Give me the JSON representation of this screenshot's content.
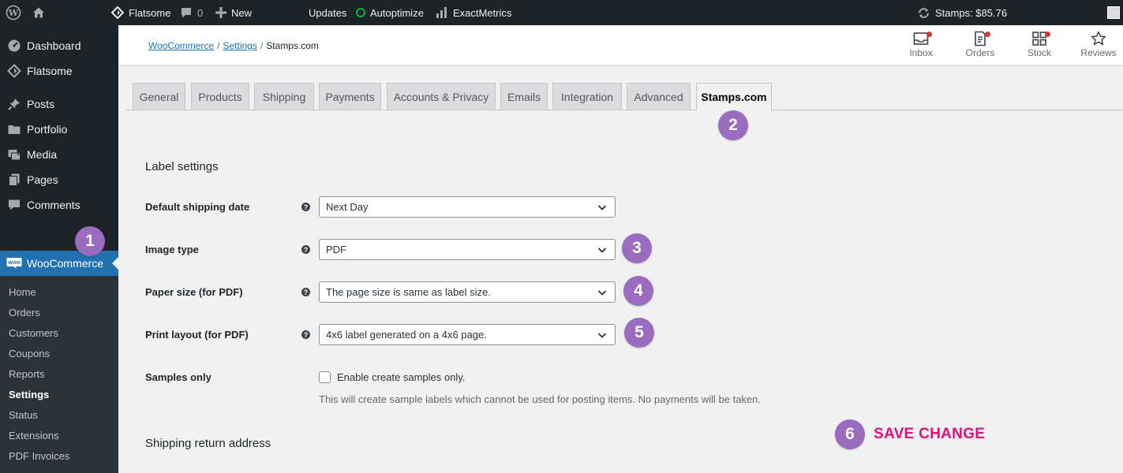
{
  "admin_bar": {
    "site_name": "Flatsome",
    "comments_count": "0",
    "new_label": "New",
    "updates_label": "Updates",
    "autoptimize_label": "Autoptimize",
    "exactmetrics_label": "ExactMetrics",
    "stamps_balance": "Stamps: $85.76"
  },
  "sidebar": {
    "items": [
      {
        "label": "Dashboard",
        "icon": "dashboard-icon"
      },
      {
        "label": "Flatsome",
        "icon": "flatsome-icon"
      },
      {
        "label": "Posts",
        "icon": "pin-icon"
      },
      {
        "label": "Portfolio",
        "icon": "folder-icon"
      },
      {
        "label": "Media",
        "icon": "media-icon"
      },
      {
        "label": "Pages",
        "icon": "pages-icon"
      },
      {
        "label": "Comments",
        "icon": "comment-icon"
      },
      {
        "label": "WooCommerce",
        "icon": "woo-icon"
      }
    ],
    "submenu": [
      "Home",
      "Orders",
      "Customers",
      "Coupons",
      "Reports",
      "Settings",
      "Status",
      "Extensions",
      "PDF Invoices"
    ],
    "active_submenu": "Settings"
  },
  "header": {
    "breadcrumb": {
      "woocommerce": "WooCommerce",
      "settings": "Settings",
      "current": "Stamps.com",
      "sep": "/"
    },
    "buttons": [
      {
        "label": "Inbox",
        "icon": "inbox-icon"
      },
      {
        "label": "Orders",
        "icon": "orders-icon"
      },
      {
        "label": "Stock",
        "icon": "stock-icon"
      },
      {
        "label": "Reviews",
        "icon": "star-icon"
      }
    ]
  },
  "tabs": [
    "General",
    "Products",
    "Shipping",
    "Payments",
    "Accounts & Privacy",
    "Emails",
    "Integration",
    "Advanced",
    "Stamps.com"
  ],
  "active_tab": "Stamps.com",
  "form": {
    "section_label": "Label settings",
    "default_shipping_date": {
      "label": "Default shipping date",
      "value": "Next Day"
    },
    "image_type": {
      "label": "Image type",
      "value": "PDF"
    },
    "paper_size": {
      "label": "Paper size (for PDF)",
      "value": "The page size is same as label size."
    },
    "print_layout": {
      "label": "Print layout (for PDF)",
      "value": "4x6 label generated on a 4x6 page."
    },
    "samples_only": {
      "label": "Samples only",
      "checkbox_label": "Enable create samples only.",
      "description": "This will create sample labels which cannot be used for posting items. No payments will be taken."
    },
    "section_return": "Shipping return address"
  },
  "annotations": {
    "badges": [
      "1",
      "2",
      "3",
      "4",
      "5",
      "6"
    ],
    "save_text": "SAVE CHANGE"
  },
  "colors": {
    "admin_dark": "#1d2327",
    "accent_blue": "#2271b1",
    "badge_purple": "#9b6bbf",
    "save_pink": "#e0117a"
  }
}
